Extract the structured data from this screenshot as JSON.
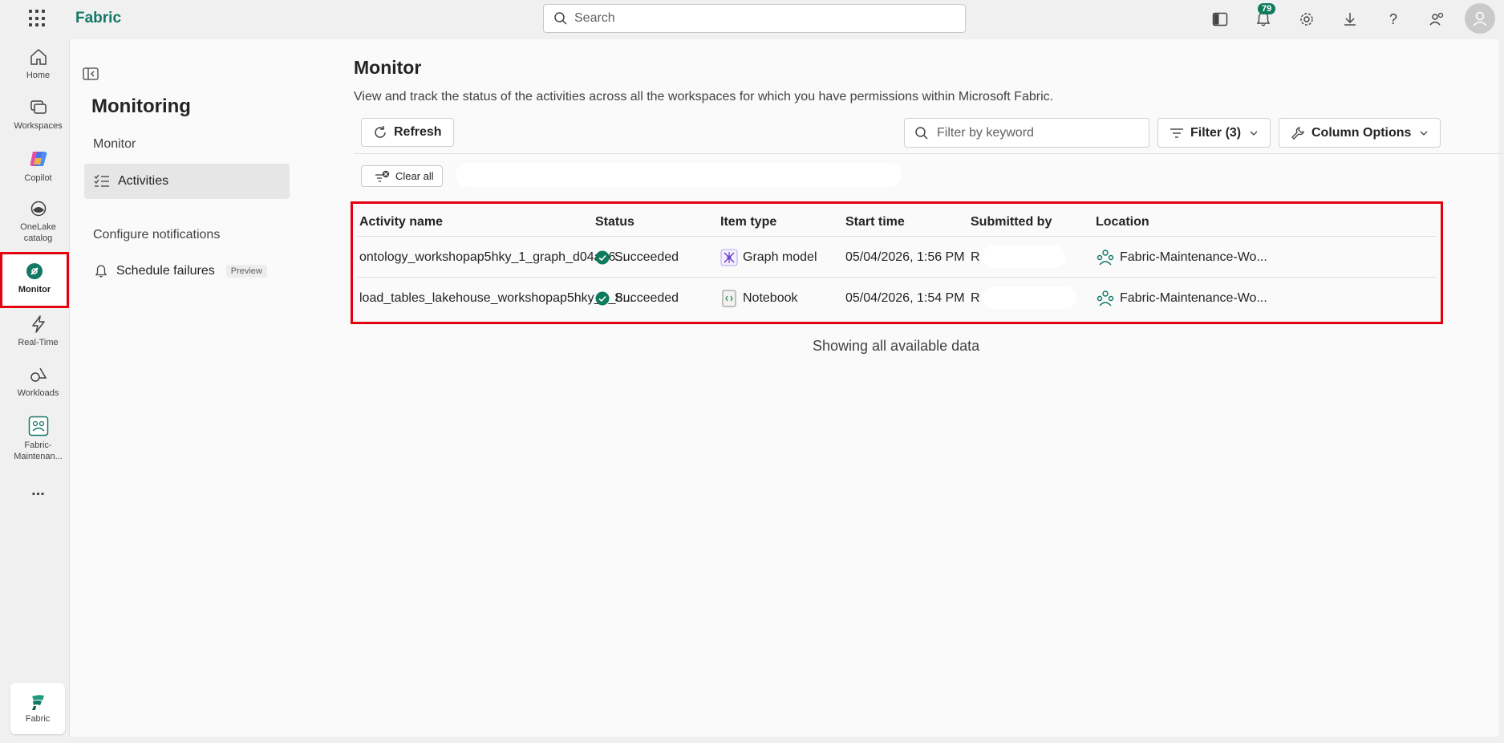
{
  "app": {
    "brand": "Fabric"
  },
  "topbar": {
    "search_placeholder": "Search",
    "notifications_count": "79"
  },
  "rail": {
    "items": [
      {
        "label": "Home",
        "icon": "home-icon"
      },
      {
        "label": "Workspaces",
        "icon": "workspaces-icon"
      },
      {
        "label": "Copilot",
        "icon": "copilot-icon"
      },
      {
        "label": "OneLake catalog",
        "icon": "onelake-icon"
      },
      {
        "label": "Monitor",
        "icon": "monitor-icon"
      },
      {
        "label": "Real-Time",
        "icon": "lightning-icon"
      },
      {
        "label": "Workloads",
        "icon": "workloads-icon"
      },
      {
        "label": "Fabric-Maintenan...",
        "icon": "workspace-icon"
      }
    ],
    "more_label": "...",
    "footer_label": "Fabric"
  },
  "subnav": {
    "title": "Monitoring",
    "section_monitor": "Monitor",
    "activities_label": "Activities",
    "section_notifications": "Configure notifications",
    "schedule_label": "Schedule failures",
    "preview_badge": "Preview"
  },
  "main": {
    "title": "Monitor",
    "description": "View and track the status of the activities across all the workspaces for which you have permissions within Microsoft Fabric.",
    "refresh_label": "Refresh",
    "filter_placeholder": "Filter by keyword",
    "filter_label": "Filter (3)",
    "column_options_label": "Column Options",
    "clear_all_label": "Clear all",
    "showing_text": "Showing all available data"
  },
  "table": {
    "columns": [
      "Activity name",
      "Status",
      "Item type",
      "Start time",
      "Submitted by",
      "Location"
    ],
    "rows": [
      {
        "activity": "ontology_workshopap5hky_1_graph_d04a86...",
        "status": "Succeeded",
        "item_type": "Graph model",
        "start_time": "05/04/2026, 1:56 PM",
        "submitted_by": "R",
        "location": "Fabric-Maintenance-Wo..."
      },
      {
        "activity": "load_tables_lakehouse_workshopap5hky_1_8...",
        "status": "Succeeded",
        "item_type": "Notebook",
        "start_time": "05/04/2026, 1:54 PM",
        "submitted_by": "R",
        "location": "Fabric-Maintenance-Wo..."
      }
    ]
  },
  "colors": {
    "accent": "#117865",
    "highlight": "#e3000f",
    "success": "#0f7b5c"
  }
}
